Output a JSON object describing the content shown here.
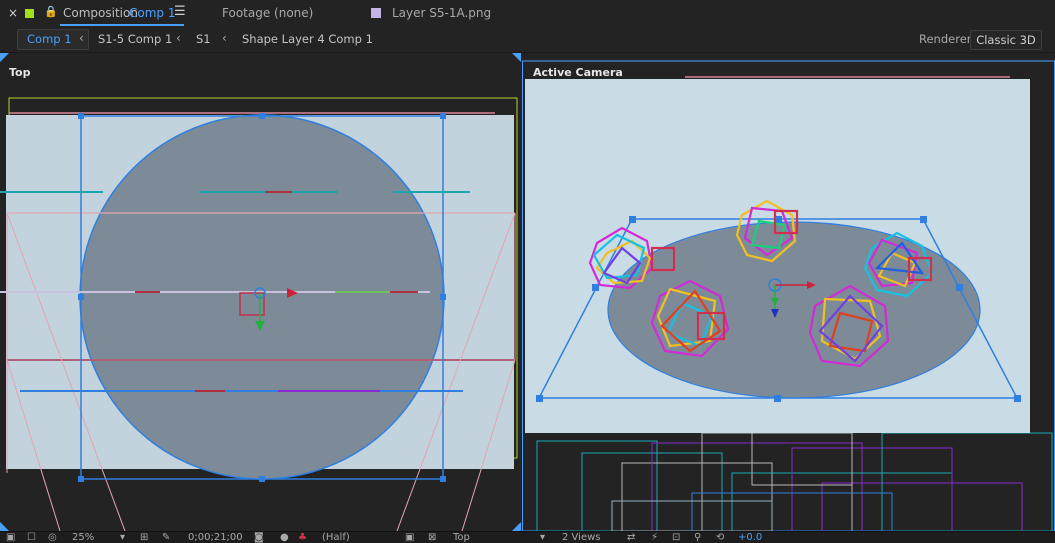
{
  "tabs": {
    "close_glyph": "×",
    "composition_prefix": "Composition",
    "composition_name": "Comp 1",
    "footage": "Footage  (none)",
    "layer": "Layer  S5-1A.png"
  },
  "breadcrumbs": [
    "Comp 1",
    "S1-5 Comp 1",
    "S1",
    "Shape Layer 4 Comp 1"
  ],
  "renderer": {
    "label": "Renderer:",
    "value": "Classic 3D"
  },
  "views": {
    "left_label": "Top",
    "right_label": "Active Camera"
  },
  "statusbar": {
    "zoom": "25%",
    "timecode": "0;00;21;00",
    "resolution": "(Half)",
    "view": "Top",
    "views_count": "2 Views",
    "exposure": "+0.0"
  },
  "colors": {
    "accent": "#4aa0ff",
    "active_swatch": "#a2e01a",
    "layer_swatch": "#c3b4e6"
  }
}
